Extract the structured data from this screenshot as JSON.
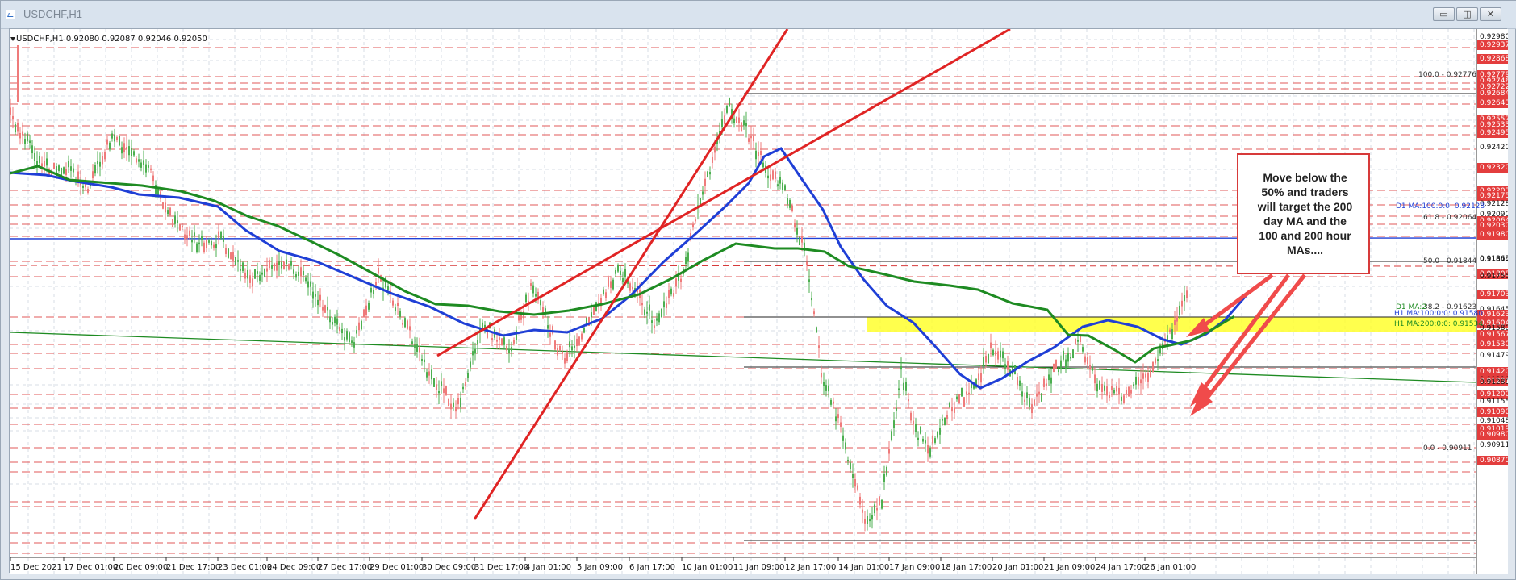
{
  "window": {
    "title": "USDCHF,H1",
    "controls": {
      "minimize": "▭",
      "restore": "◫",
      "close": "✕"
    }
  },
  "chart": {
    "symbol_text": "USDCHF,H1  0.92080 0.92087 0.92046 0.92050",
    "callout_lines": [
      "Move below the",
      "50% and traders",
      "will target the 200",
      "day MA and the",
      "100 and 200 hour",
      "MAs...."
    ],
    "x_axis_labels": [
      "15 Dec 2021",
      "17 Dec 01:00",
      "20 Dec 09:00",
      "21 Dec 17:00",
      "23 Dec 01:00",
      "24 Dec 09:00",
      "27 Dec 17:00",
      "29 Dec 01:00",
      "30 Dec 09:00",
      "31 Dec 17:00",
      "4 Jan 01:00",
      "5 Jan 09:00",
      "6 Jan 17:00",
      "10 Jan 01:00",
      "11 Jan 09:00",
      "12 Jan 17:00",
      "14 Jan 01:00",
      "17 Jan 09:00",
      "18 Jan 17:00",
      "20 Jan 01:00",
      "21 Jan 09:00",
      "24 Jan 17:00",
      "26 Jan 01:00"
    ],
    "y_axis_labels": [
      "0.92980",
      "0.92937",
      "0.92868",
      "0.92779",
      "0.92746",
      "0.92722",
      "0.92684",
      "0.92643",
      "0.92557",
      "0.92533",
      "0.92495",
      "0.92420",
      "0.92320",
      "0.92203",
      "0.92175",
      "0.92128",
      "0.92090",
      "0.92064",
      "0.92050",
      "0.92030",
      "0.91980",
      "0.91865",
      "0.91844",
      "0.91808",
      "0.91755",
      "0.91703",
      "0.91645",
      "0.91623",
      "0.91604",
      "0.91580",
      "0.91567",
      "0.91534",
      "0.91530",
      "0.91479",
      "0.91420",
      "0.91310",
      "0.91291",
      "0.91280",
      "0.91200",
      "0.91155",
      "0.91090",
      "0.91048",
      "0.91019",
      "0.90980",
      "0.90911",
      "0.90870"
    ],
    "annotations": {
      "fib_100": "100.0 - 0.92776",
      "fib_618": "61.8 - 0.92064",
      "fib_50": "50.0 - 0.91844",
      "fib_382": "38.2 - 0.91623",
      "fib_0": "0.0 - 0.90911",
      "d1_ma100": "D1 MA:100:0:0: 0.92128",
      "d1_ma200": "D1 MA:2",
      "h1_ma100": "H1 MA:100:0:0: 0.91580",
      "h1_ma200": "H1 MA:200:0:0: 0.91534"
    },
    "colors": {
      "background": "#ffffff",
      "grid": "#d8dde5",
      "candle_up": "#4caf50",
      "candle_down": "#ef7b7b",
      "ma_blue": "#1f3fd6",
      "ma_green": "#1e8b22",
      "trend_red": "#e02424",
      "fib_zone": "#ffff2e",
      "fib_line": "#444444"
    }
  }
}
